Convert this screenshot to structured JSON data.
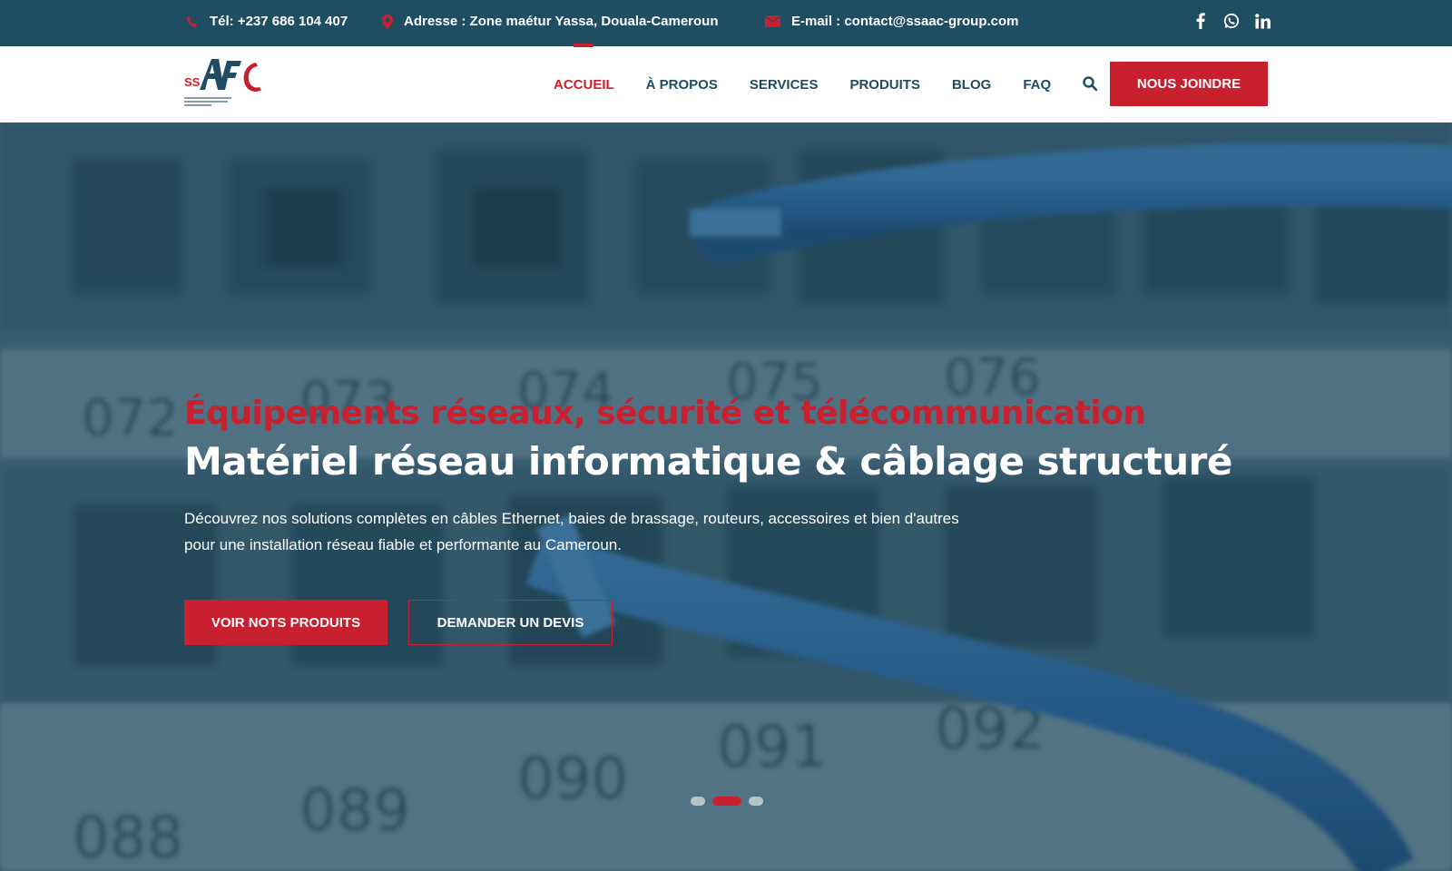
{
  "topbar": {
    "phone": "Tél: +237 686 104 407",
    "address": "Adresse : Zone maétur Yassa, Douala-Cameroun",
    "email": "E-mail : contact@ssaac-group.com",
    "social": [
      {
        "name": "facebook-icon",
        "glyph": "f"
      },
      {
        "name": "whatsapp-icon",
        "glyph": ""
      },
      {
        "name": "linkedin-icon",
        "glyph": "in"
      }
    ]
  },
  "header": {
    "logo_text": "SSAAC",
    "nav": [
      {
        "label": "ACCUEIL",
        "active": true
      },
      {
        "label": "À PROPOS",
        "active": false
      },
      {
        "label": "SERVICES",
        "active": false
      },
      {
        "label": "PRODUITS",
        "active": false
      },
      {
        "label": "BLOG",
        "active": false
      },
      {
        "label": "FAQ",
        "active": false
      }
    ],
    "join_button": "NOUS JOINDRE"
  },
  "hero": {
    "kicker": "Équipements réseaux, sécurité et télécommunication",
    "headline": "Matériel réseau informatique & câblage structuré",
    "description_line1": "Découvrez nos solutions complètes en câbles Ethernet, baies de brassage, routeurs, accessoires et bien d'autres",
    "description_line2": "pour une installation réseau fiable et performante au Cameroun.",
    "primary_cta": "VOIR NOTS PRODUITS",
    "secondary_cta": "DEMANDER UN DEVIS",
    "port_labels": [
      "072",
      "073",
      "074",
      "075",
      "076",
      "088",
      "089",
      "090",
      "091",
      "092"
    ],
    "slides": 3,
    "active_slide": 2
  },
  "colors": {
    "brand_blue": "#1f4d62",
    "brand_red": "#c8202f"
  }
}
